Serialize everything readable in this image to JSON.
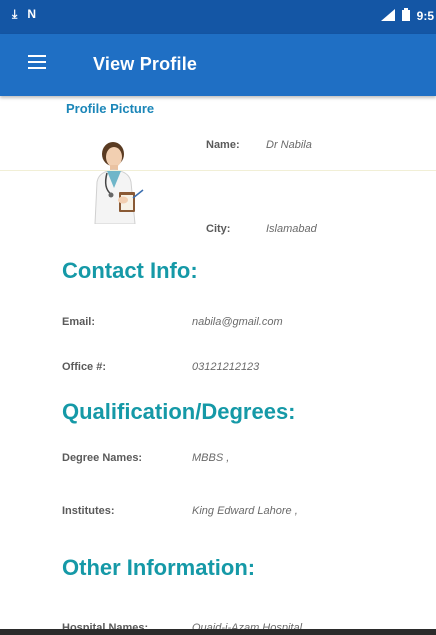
{
  "status_bar": {
    "left_icons": [
      "download-icon",
      "n-icon"
    ],
    "right_icons": [
      "signal-icon",
      "battery-icon"
    ],
    "time": "9:5"
  },
  "app_bar": {
    "title": "View Profile",
    "menu_icon": "hamburger-menu-icon"
  },
  "profile": {
    "section_label": "Profile Picture",
    "name_label": "Name:",
    "name_value": "Dr Nabila",
    "city_label": "City:",
    "city_value": "Islamabad"
  },
  "contact": {
    "heading": "Contact Info:",
    "email_label": "Email:",
    "email_value": "nabila@gmail.com",
    "office_label": "Office #:",
    "office_value": "03121212123"
  },
  "qualification": {
    "heading": "Qualification/Degrees:",
    "degree_label": "Degree Names:",
    "degree_value": "MBBS ,",
    "institutes_label": "Institutes:",
    "institutes_value": "King Edward Lahore ,"
  },
  "other": {
    "heading": "Other Information:",
    "hospital_label": "Hospital Names:",
    "hospital_value": "Quaid-i-Azam Hospital ,"
  },
  "colors": {
    "status_bar": "#1456a5",
    "app_bar": "#1f6fc4",
    "heading": "#1599a7",
    "section_label": "#1b86b8"
  }
}
